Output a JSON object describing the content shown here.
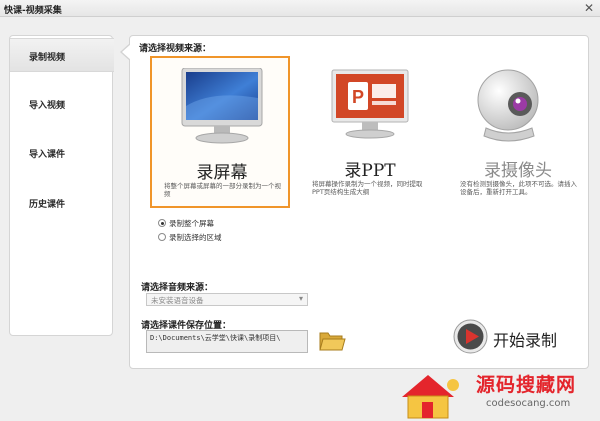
{
  "window": {
    "title": "快课-视频采集",
    "close_glyph": "✕"
  },
  "sidebar": {
    "items": [
      {
        "label": "录制视频",
        "active": true
      },
      {
        "label": "导入视频",
        "active": false
      },
      {
        "label": "导入课件",
        "active": false
      },
      {
        "label": "历史课件",
        "active": false
      }
    ]
  },
  "main": {
    "video_source_label": "请选择视频来源：",
    "sources": [
      {
        "title": "录屏幕",
        "desc": "将整个屏幕或屏幕的一部分录制为一个视频",
        "icon": "monitor-icon",
        "selected": true,
        "disabled": false
      },
      {
        "title": "录PPT",
        "desc": "将屏幕操作录制为一个视频，同时提取PPT页结构生成大纲",
        "icon": "powerpoint-icon",
        "selected": false,
        "disabled": false
      },
      {
        "title": "录摄像头",
        "desc": "没有检测到摄像头，此项不可选。请插入设备后，重新打开工具。",
        "icon": "webcam-icon",
        "selected": false,
        "disabled": true
      }
    ],
    "capture_options": [
      {
        "label": "录制整个屏幕",
        "checked": true
      },
      {
        "label": "录制选择的区域",
        "checked": false
      }
    ],
    "audio_source_label": "请选择音频来源：",
    "audio_device": "未安装语音设备",
    "save_location_label": "请选择课件保存位置：",
    "save_path": "D:\\Documents\\云学堂\\快课\\录制项目\\",
    "start_record_label": "开始录制"
  },
  "watermark": {
    "text": "源码搜藏网",
    "url": "codesocang.com"
  },
  "colors": {
    "accent": "#f0952a",
    "record_red": "#c9302c",
    "watermark_red": "#e4252c"
  }
}
